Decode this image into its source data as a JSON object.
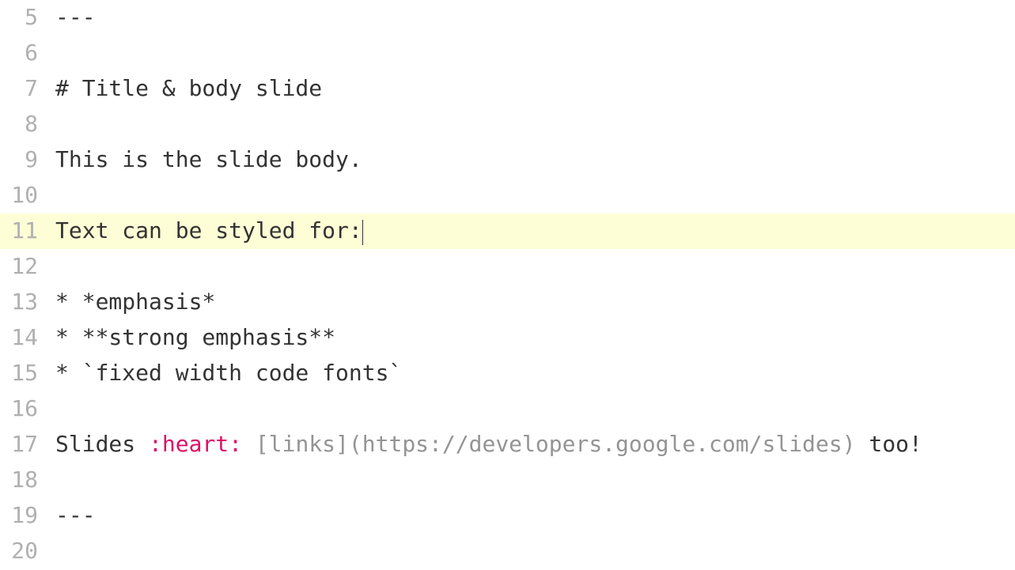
{
  "editor": {
    "lines": [
      {
        "number": "5",
        "highlighted": false,
        "segments": [
          {
            "text": "---",
            "cls": ""
          }
        ]
      },
      {
        "number": "6",
        "highlighted": false,
        "segments": []
      },
      {
        "number": "7",
        "highlighted": false,
        "segments": [
          {
            "text": "# Title & body slide",
            "cls": ""
          }
        ]
      },
      {
        "number": "8",
        "highlighted": false,
        "segments": []
      },
      {
        "number": "9",
        "highlighted": false,
        "segments": [
          {
            "text": "This is the slide body.",
            "cls": ""
          }
        ]
      },
      {
        "number": "10",
        "highlighted": false,
        "segments": []
      },
      {
        "number": "11",
        "highlighted": true,
        "cursor": true,
        "segments": [
          {
            "text": "Text can be styled for:",
            "cls": ""
          }
        ]
      },
      {
        "number": "12",
        "highlighted": false,
        "segments": []
      },
      {
        "number": "13",
        "highlighted": false,
        "segments": [
          {
            "text": "* *emphasis*",
            "cls": ""
          }
        ]
      },
      {
        "number": "14",
        "highlighted": false,
        "segments": [
          {
            "text": "* **strong emphasis**",
            "cls": ""
          }
        ]
      },
      {
        "number": "15",
        "highlighted": false,
        "segments": [
          {
            "text": "* `fixed width code fonts`",
            "cls": ""
          }
        ]
      },
      {
        "number": "16",
        "highlighted": false,
        "segments": []
      },
      {
        "number": "17",
        "highlighted": false,
        "segments": [
          {
            "text": "Slides ",
            "cls": ""
          },
          {
            "text": ":heart:",
            "cls": "emoji"
          },
          {
            "text": " ",
            "cls": ""
          },
          {
            "text": "[links](https://developers.google.com/slides)",
            "cls": "link-part"
          },
          {
            "text": " too!",
            "cls": ""
          }
        ]
      },
      {
        "number": "18",
        "highlighted": false,
        "segments": []
      },
      {
        "number": "19",
        "highlighted": false,
        "segments": [
          {
            "text": "---",
            "cls": ""
          }
        ]
      },
      {
        "number": "20",
        "highlighted": false,
        "segments": []
      }
    ]
  }
}
